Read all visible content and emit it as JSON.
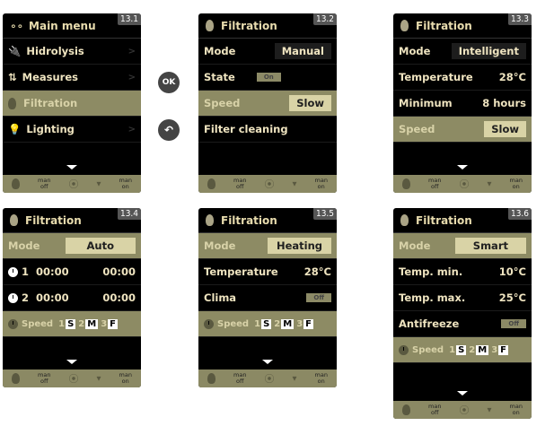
{
  "s1": {
    "num": "13.1",
    "title": "Main menu",
    "items": [
      "Hidrolysis",
      "Measures",
      "Filtration",
      "Lighting"
    ]
  },
  "s2": {
    "num": "13.2",
    "title": "Filtration",
    "mode_label": "Mode",
    "mode_val": "Manual",
    "state_label": "State",
    "state_val": "On",
    "speed_label": "Speed",
    "speed_val": "Slow",
    "clean": "Filter cleaning"
  },
  "s3": {
    "num": "13.3",
    "title": "Filtration",
    "mode_label": "Mode",
    "mode_val": "Intelligent",
    "temp_label": "Temperature",
    "temp_val": "28°C",
    "min_label": "Minimum",
    "min_val": "8 hours",
    "speed_label": "Speed",
    "speed_val": "Slow"
  },
  "s4": {
    "num": "13.4",
    "title": "Filtration",
    "mode_label": "Mode",
    "mode_val": "Auto",
    "t1_num": "1",
    "t1_a": "00:00",
    "t1_b": "00:00",
    "t2_num": "2",
    "t2_a": "00:00",
    "t2_b": "00:00",
    "speed_label": "Speed"
  },
  "s5": {
    "num": "13.5",
    "title": "Filtration",
    "mode_label": "Mode",
    "mode_val": "Heating",
    "temp_label": "Temperature",
    "temp_val": "28°C",
    "clima_label": "Clima",
    "clima_val": "Off",
    "speed_label": "Speed"
  },
  "s6": {
    "num": "13.6",
    "title": "Filtration",
    "mode_label": "Mode",
    "mode_val": "Smart",
    "tmin_label": "Temp. min.",
    "tmin_val": "10°C",
    "tmax_label": "Temp. max.",
    "tmax_val": "25°C",
    "anti_label": "Antifreeze",
    "anti_val": "Off",
    "speed_label": "Speed"
  },
  "speed_levels": [
    "1",
    "S",
    "2",
    "M",
    "3",
    "F"
  ],
  "footer": {
    "man_off_1": "man",
    "man_off_2": "off",
    "man_on_1": "man",
    "man_on_2": "on"
  },
  "ok_label": "OK"
}
